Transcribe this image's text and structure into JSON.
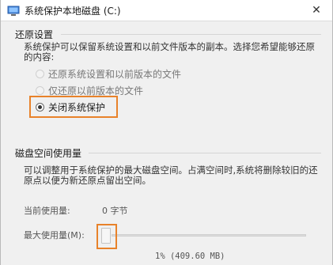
{
  "window": {
    "title": "系统保护本地磁盘 (C:)"
  },
  "restore_settings": {
    "group_title": "还原设置",
    "description": "系统保护可以保留系统设置和以前文件版本的副本。选择您希望能够还原的内容:",
    "options": [
      {
        "label": "还原系统设置和以前版本的文件",
        "selected": false,
        "enabled": false
      },
      {
        "label": "仅还原以前版本的文件",
        "selected": false,
        "enabled": false
      },
      {
        "label": "关闭系统保护",
        "selected": true,
        "enabled": true
      }
    ]
  },
  "disk_space": {
    "group_title": "磁盘空间使用量",
    "description": "可以调整用于系统保护的最大磁盘空间。占满空间时,系统将删除较旧的还原点以便为新还原点留出空间。",
    "current_usage_label": "当前使用量:",
    "current_usage_value": "0 字节",
    "max_usage_label": "最大使用量(M):",
    "max_usage_display": "1% (409.60 MB)",
    "max_usage_fraction": 0.01
  },
  "colors": {
    "highlight": "#e8822a",
    "window_bg": "#f0f0f0"
  },
  "icons": {
    "app": "system-protection-icon",
    "close": "close-icon"
  }
}
